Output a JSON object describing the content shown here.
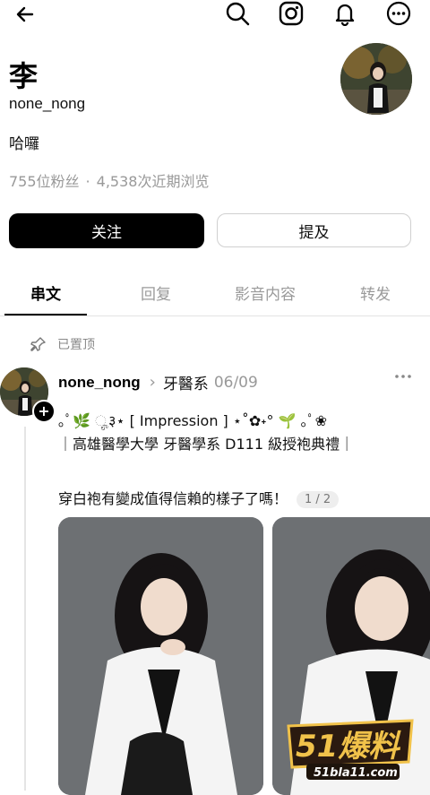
{
  "profile": {
    "name": "李",
    "handle": "none_nong",
    "bio": "哈囉",
    "followers": "755位粉丝",
    "dot": "·",
    "views": "4,538次近期浏览"
  },
  "actions": {
    "follow_label": "关注",
    "mention_label": "提及"
  },
  "tabs": [
    {
      "label": "串文",
      "active": true
    },
    {
      "label": "回复",
      "active": false
    },
    {
      "label": "影音内容",
      "active": false
    },
    {
      "label": "转发",
      "active": false
    }
  ],
  "pinned_label": "已置顶",
  "post": {
    "username": "none_nong",
    "category": "牙醫系",
    "date": "06/09",
    "line1": "｡ﾟ🌿 ೄ३⋆ [ Impression ] ⋆˚✿˖° 🌱 ｡ﾟ❀",
    "line2": "｜高雄醫學大學 牙醫學系 D111 級授袍典禮｜",
    "line3": "穿白袍有變成值得信賴的樣子了嗎！",
    "pager": "1 / 2",
    "plus": "+"
  },
  "watermark": {
    "brand": "51爆料",
    "url": "51bla11.com"
  },
  "icons": {
    "back": "arrow-left-icon",
    "search": "search-icon",
    "instagram": "instagram-icon",
    "notifications": "bell-icon",
    "more": "more-circle-icon",
    "pin": "pin-icon",
    "post_more": "more-horizontal-icon"
  },
  "colors": {
    "primary": "#000000",
    "muted": "#999999",
    "border": "#d0d0d0",
    "watermark_gold": "#f1c24a"
  }
}
